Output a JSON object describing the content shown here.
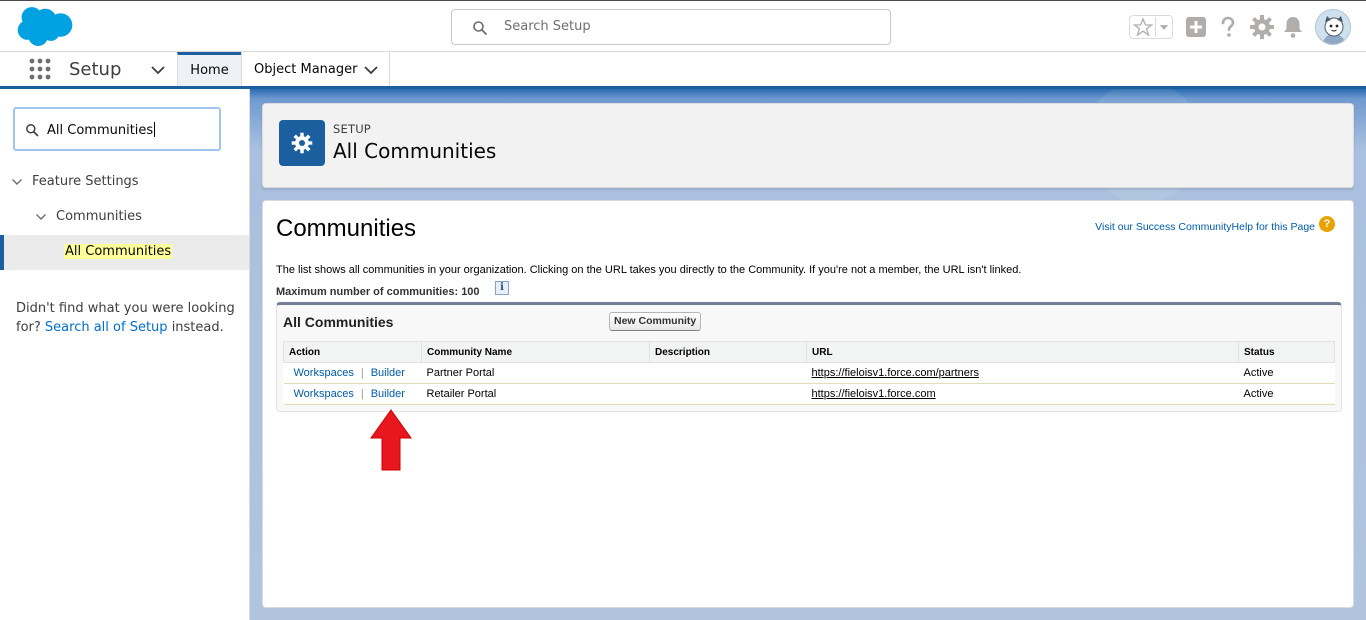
{
  "header": {
    "search_placeholder": "Search Setup"
  },
  "context_bar": {
    "app_name": "Setup",
    "tabs": [
      {
        "label": "Home"
      },
      {
        "label": "Object Manager"
      }
    ]
  },
  "sidebar": {
    "quick_find_value": "All Communities",
    "tree": [
      {
        "label": "Feature Settings"
      },
      {
        "label": "Communities"
      },
      {
        "label": "All Communities"
      }
    ],
    "not_found_text": "Didn't find what you were looking for?",
    "not_found_link": "Search all of Setup",
    "not_found_suffix": "instead."
  },
  "page_header": {
    "eyebrow": "SETUP",
    "title": "All Communities"
  },
  "content": {
    "title": "Communities",
    "success_link": "Visit our Success Community",
    "help_link": "Help for this Page",
    "help_icon_glyph": "?",
    "description": "The list shows all communities in your organization. Clicking on the URL takes you directly to the Community. If you're not a member, the URL isn't linked.",
    "max_label": "Maximum number of communities: 100",
    "info_glyph": "i"
  },
  "list": {
    "title": "All Communities",
    "new_button": "New Community",
    "columns": [
      "Action",
      "Community Name",
      "Description",
      "URL",
      "Status"
    ],
    "action_links": [
      "Workspaces",
      "Builder"
    ],
    "action_separator": "|",
    "rows": [
      {
        "name": "Partner Portal",
        "description": "",
        "url": "https://fieloisv1.force.com/partners",
        "status": "Active"
      },
      {
        "name": "Retailer Portal",
        "description": "",
        "url": "https://fieloisv1.force.com",
        "status": "Active"
      }
    ]
  },
  "colors": {
    "brand": "#1b5f9e",
    "link": "#015ba7",
    "annotation_arrow": "#e8171d",
    "highlight": "#ffff99"
  }
}
